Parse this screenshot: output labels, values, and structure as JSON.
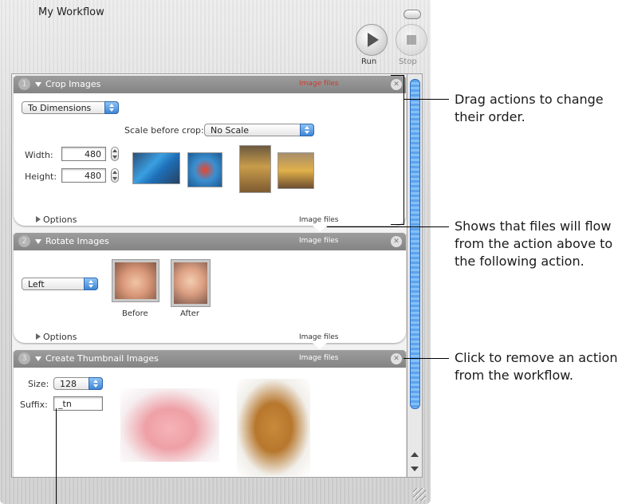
{
  "window": {
    "title": "My Workflow"
  },
  "toolbar": {
    "run_label": "Run",
    "stop_label": "Stop"
  },
  "actions": [
    {
      "number": "1",
      "title": "Crop Images",
      "header_type": "Image files",
      "mode": "To Dimensions",
      "scale_label": "Scale before crop:",
      "scale_value": "No Scale",
      "width_label": "Width:",
      "width_value": "480",
      "height_label": "Height:",
      "height_value": "480",
      "options_label": "Options",
      "footer_type": "Image files"
    },
    {
      "number": "2",
      "title": "Rotate Images",
      "header_type": "Image files",
      "direction": "Left",
      "before_label": "Before",
      "after_label": "After",
      "options_label": "Options",
      "footer_type": "Image files"
    },
    {
      "number": "3",
      "title": "Create Thumbnail Images",
      "header_type": "Image files",
      "size_label": "Size:",
      "size_value": "128",
      "suffix_label": "Suffix:",
      "suffix_value": "_tn"
    }
  ],
  "callouts": {
    "drag": "Drag actions to change their order.",
    "flow": "Shows that files will flow from the action above to the following action.",
    "remove": "Click to remove an action from the workflow."
  },
  "colors": {
    "accent": "#3e86d6",
    "header": "#8f8f8f",
    "red_label": "#d03a2a"
  }
}
